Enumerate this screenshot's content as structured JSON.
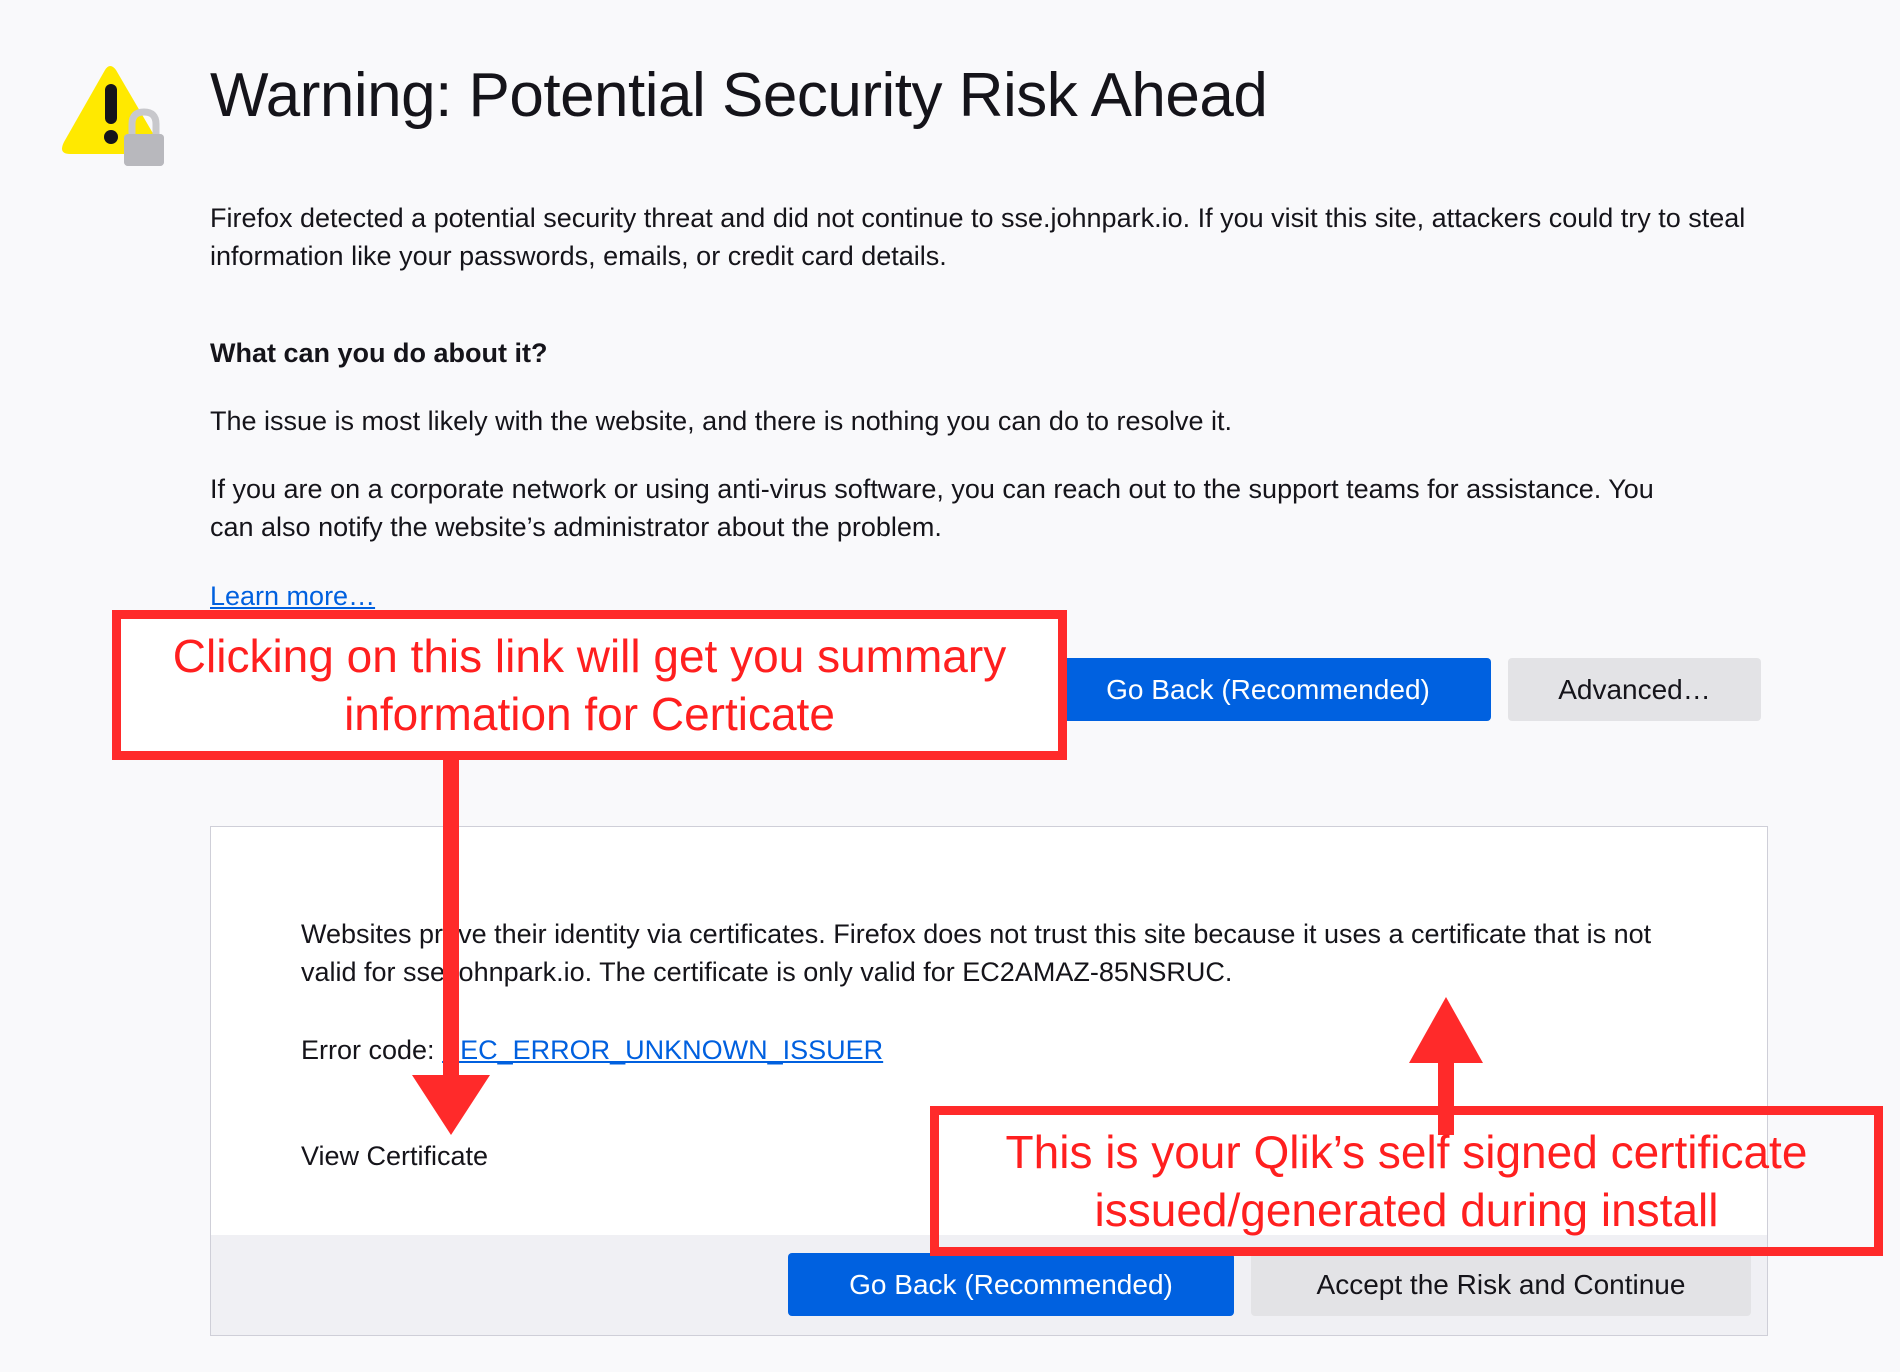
{
  "page": {
    "title": "Warning: Potential Security Risk Ahead",
    "intro": "Firefox detected a potential security threat and did not continue to sse.johnpark.io. If you visit this site, attackers could try to steal information like your passwords, emails, or credit card details.",
    "what_heading": "What can you do about it?",
    "para1": "The issue is most likely with the website, and there is nothing you can do to resolve it.",
    "para2": "If you are on a corporate network or using anti-virus software, you can reach out to the support teams for assistance. You can also notify the website’s administrator about the problem.",
    "learn_more": "Learn more…",
    "go_back_label": "Go Back (Recommended)",
    "advanced_label": "Advanced…"
  },
  "advanced_panel": {
    "description": "Websites prove their identity via certificates. Firefox does not trust this site because it uses a certificate that is not valid for sse.johnpark.io. The certificate is only valid for EC2AMAZ-85NSRUC.",
    "error_code_label": "Error code:",
    "error_code": "SEC_ERROR_UNKNOWN_ISSUER",
    "view_certificate": "View Certificate",
    "go_back_label": "Go Back (Recommended)",
    "accept_label": "Accept the Risk and Continue"
  },
  "annotations": {
    "link_note": "Clicking on this link will get you summary information for Certicate",
    "cert_note": "This is your Qlik’s self signed certificate issued/generated during install"
  },
  "colors": {
    "accent_blue": "#0061e0",
    "annotation_red": "#ff2a2a",
    "warning_yellow": "#ffe900"
  },
  "icons": {
    "warning": "warning-lock-icon"
  }
}
